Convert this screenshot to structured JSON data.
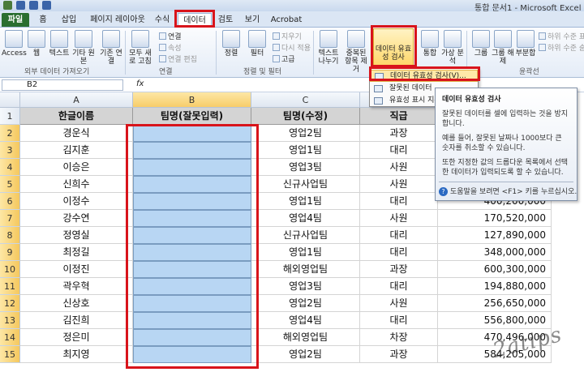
{
  "window": {
    "title": "통합 문서1 - Microsoft Excel"
  },
  "tabs": [
    "파일",
    "홈",
    "삽입",
    "페이지 레이아웃",
    "수식",
    "데이터",
    "검토",
    "보기",
    "Acrobat"
  ],
  "active_tab": "데이터",
  "ribbon": {
    "get_external": {
      "buttons": [
        "Access",
        "웹",
        "텍스트",
        "기타 원본",
        "기존 연결"
      ],
      "label": "외부 데이터 가져오기"
    },
    "connections": {
      "buttons": [
        "모두 새로 고침"
      ],
      "small": [
        "연결",
        "속성",
        "연결 편집"
      ],
      "label": "연결"
    },
    "sort_filter": {
      "buttons": [
        "정렬",
        "필터"
      ],
      "small": [
        "지우기",
        "다시 적용",
        "고급"
      ],
      "label": "정렬 및 필터"
    },
    "data_tools": {
      "buttons": [
        "텍스트 나누기",
        "중복된 항목 제거",
        "데이터 유효성 검사",
        "통합",
        "가상 분석"
      ]
    },
    "outline": {
      "buttons": [
        "그룹",
        "그룹 해제",
        "부분합"
      ],
      "small": [
        "하위 수준 표시",
        "하위 수준 숨기기"
      ],
      "label": "윤곽선"
    }
  },
  "formula_bar": {
    "name_box": "B2",
    "fx": "fx"
  },
  "columns": [
    "A",
    "B",
    "C",
    "D"
  ],
  "rows": [
    [
      "한글이름",
      "팀명(잘못입력)",
      "팀명(수정)",
      "직급",
      ""
    ],
    [
      "경운식",
      "",
      "영업2팀",
      "과장",
      ""
    ],
    [
      "김지훈",
      "",
      "영업1팀",
      "대리",
      ""
    ],
    [
      "이승은",
      "",
      "영업3팀",
      "사원",
      ""
    ],
    [
      "신희수",
      "",
      "신규사업팀",
      "사원",
      ""
    ],
    [
      "이정수",
      "",
      "영업1팀",
      "대리",
      "400,200,000"
    ],
    [
      "강수연",
      "",
      "영업4팀",
      "사원",
      "170,520,000"
    ],
    [
      "정영실",
      "",
      "신규사업팀",
      "대리",
      "127,890,000"
    ],
    [
      "최정길",
      "",
      "영업1팀",
      "대리",
      "348,000,000"
    ],
    [
      "이정진",
      "",
      "해외영업팀",
      "과장",
      "600,300,000"
    ],
    [
      "곽우혁",
      "",
      "영업3팀",
      "대리",
      "194,880,000"
    ],
    [
      "신상호",
      "",
      "영업2팀",
      "사원",
      "256,650,000"
    ],
    [
      "김진희",
      "",
      "영업4팀",
      "대리",
      "556,800,000"
    ],
    [
      "정은미",
      "",
      "해외영업팀",
      "차장",
      "470,496,000"
    ],
    [
      "최지영",
      "",
      "영업2팀",
      "과장",
      "584,205,000"
    ]
  ],
  "dropdown": {
    "items": [
      "데이터 유효성 검사(V)...",
      "잘못된 데이터",
      "유효성 표시 지우기"
    ]
  },
  "tooltip": {
    "title": "데이터 유효성 검사",
    "p1": "잘못된 데이터를 셀에 입력하는 것을 방지합니다.",
    "p2": "예를 들어, 잘못된 날짜나 1000보다 큰 숫자를 취소할 수 있습니다.",
    "p3": "또한 지정한 값의 드롭다운 목록에서 선택한 데이터가 입력되도록 할 수 있습니다.",
    "help": "도움말을 보려면 <F1> 키를 누르십시오."
  },
  "watermark": "2atips"
}
